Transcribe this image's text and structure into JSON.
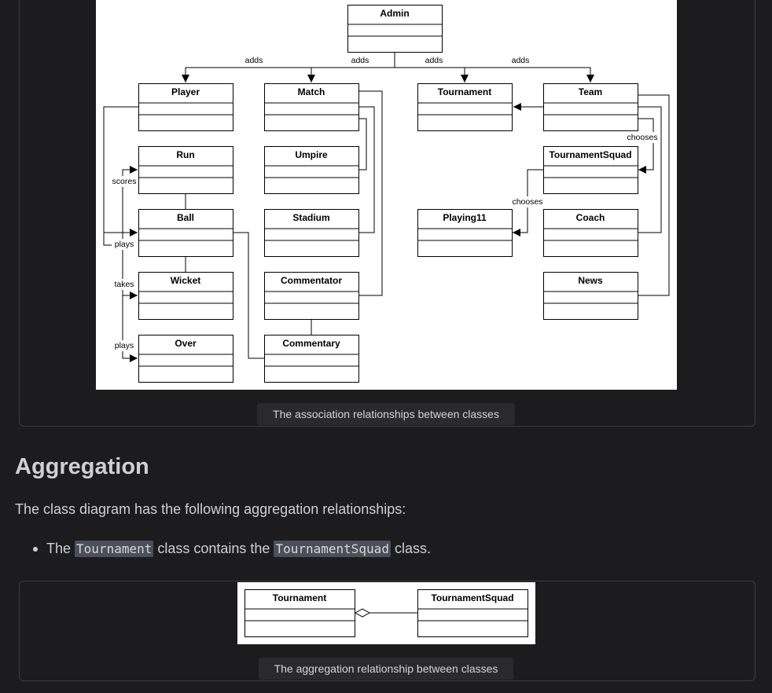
{
  "association_diagram": {
    "classes": [
      {
        "id": "admin",
        "name": "Admin"
      },
      {
        "id": "player",
        "name": "Player"
      },
      {
        "id": "match",
        "name": "Match"
      },
      {
        "id": "tournament",
        "name": "Tournament"
      },
      {
        "id": "team",
        "name": "Team"
      },
      {
        "id": "run",
        "name": "Run"
      },
      {
        "id": "umpire",
        "name": "Umpire"
      },
      {
        "id": "tournamentsquad",
        "name": "TournamentSquad"
      },
      {
        "id": "ball",
        "name": "Ball"
      },
      {
        "id": "stadium",
        "name": "Stadium"
      },
      {
        "id": "playing11",
        "name": "Playing11"
      },
      {
        "id": "coach",
        "name": "Coach"
      },
      {
        "id": "wicket",
        "name": "Wicket"
      },
      {
        "id": "commentator",
        "name": "Commentator"
      },
      {
        "id": "news",
        "name": "News"
      },
      {
        "id": "over",
        "name": "Over"
      },
      {
        "id": "commentary",
        "name": "Commentary"
      }
    ],
    "labels": {
      "adds": "adds",
      "chooses": "chooses",
      "scores": "scores",
      "plays": "plays",
      "takes": "takes"
    }
  },
  "caption1": "The association relationships between classes",
  "section": {
    "heading": "Aggregation",
    "intro": "The class diagram has the following aggregation relationships:",
    "bullet": {
      "prefix": "The ",
      "code1": "Tournament",
      "middle": " class contains the ",
      "code2": "TournamentSquad",
      "suffix": " class."
    }
  },
  "aggregation_diagram": {
    "classes": [
      {
        "id": "tournament",
        "name": "Tournament"
      },
      {
        "id": "tournamentsquad",
        "name": "TournamentSquad"
      }
    ]
  },
  "caption2": "The aggregation relationship between classes"
}
